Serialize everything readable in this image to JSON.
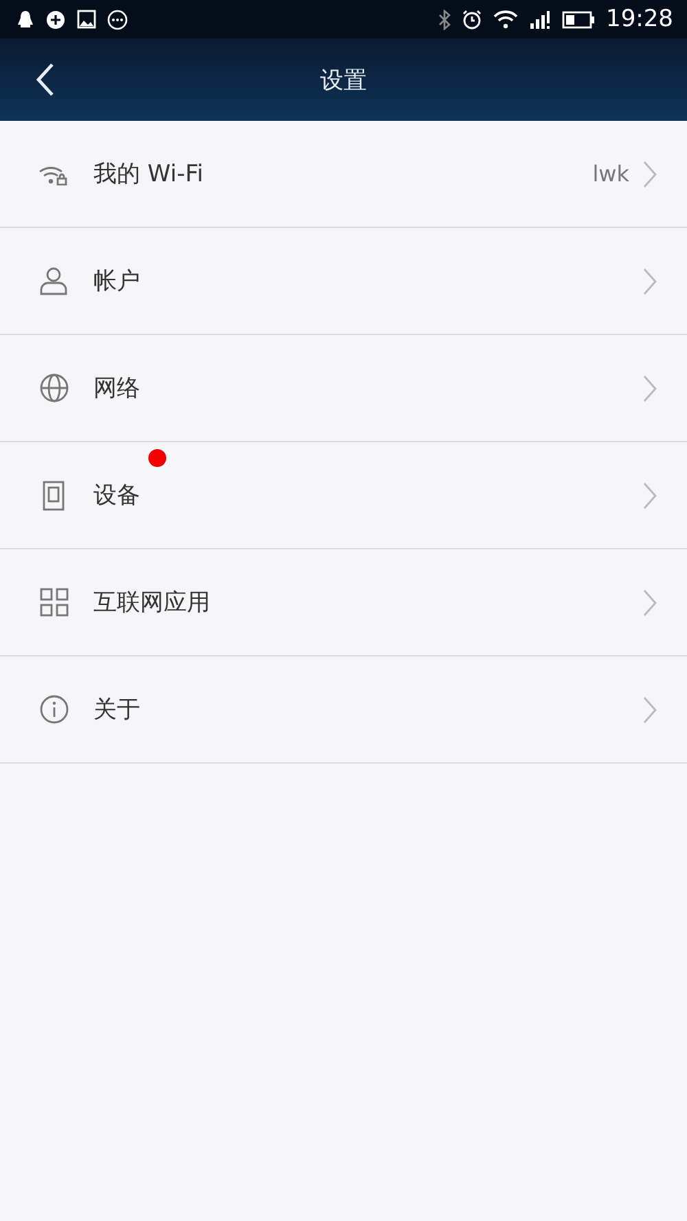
{
  "status_bar": {
    "time": "19:28"
  },
  "header": {
    "title": "设置"
  },
  "items": [
    {
      "kind": "wifi",
      "label": "我的 Wi-Fi",
      "value": "lwk",
      "badge": false
    },
    {
      "kind": "account",
      "label": "帐户",
      "badge": false
    },
    {
      "kind": "network",
      "label": "网络",
      "badge": false
    },
    {
      "kind": "device",
      "label": "设备",
      "badge": true
    },
    {
      "kind": "apps",
      "label": "互联网应用",
      "badge": false
    },
    {
      "kind": "about",
      "label": "关于",
      "badge": false
    }
  ]
}
